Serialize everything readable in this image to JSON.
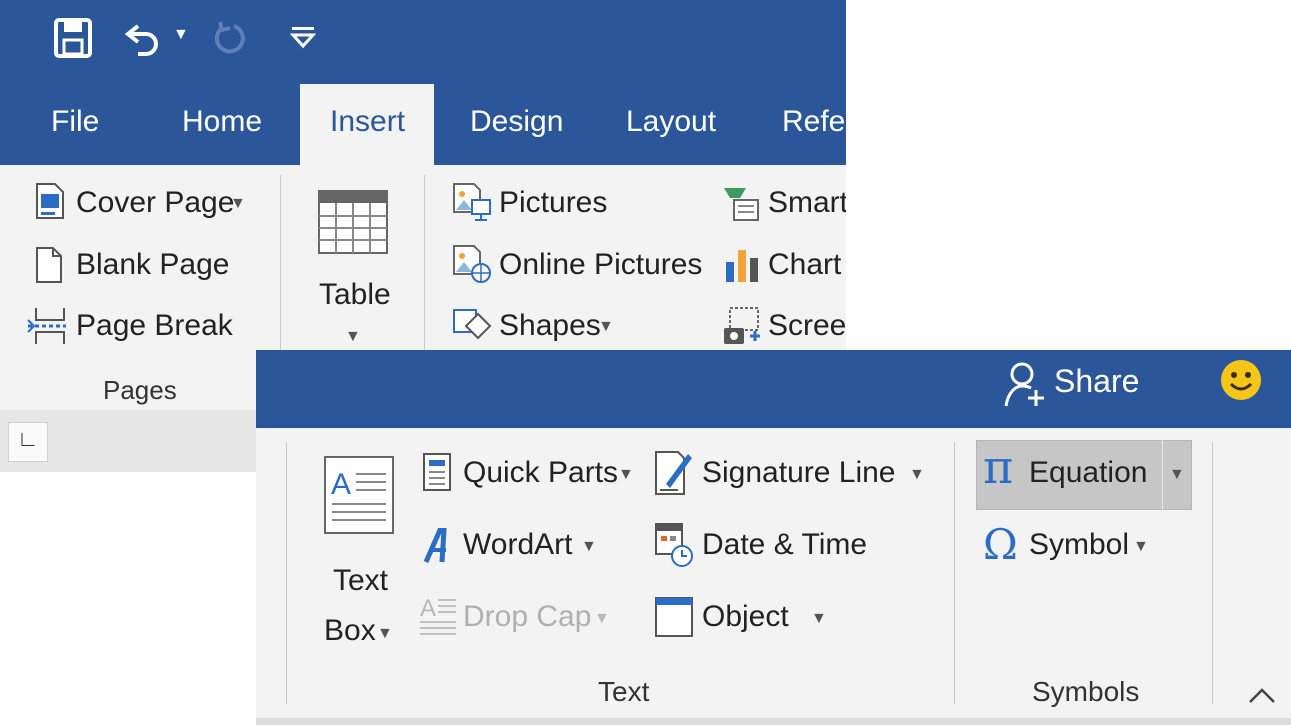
{
  "colors": {
    "title_bar": "#2b579a",
    "ribbon_bg": "#f3f3f3",
    "active_tab_bg": "#f3f3f3",
    "equation_highlight": "#c6c6c6",
    "smiley": "#f5c518"
  },
  "quick_access": {
    "save_icon": "save-icon",
    "undo_icon": "undo-icon",
    "redo_icon": "redo-icon",
    "customize_icon": "customize-qat-icon"
  },
  "tabs": [
    "File",
    "Home",
    "Insert",
    "Design",
    "Layout",
    "Refer"
  ],
  "active_tab": "Insert",
  "pages_group": {
    "items": [
      {
        "label": "Cover Page",
        "icon": "cover-page-icon",
        "has_dropdown": true
      },
      {
        "label": "Blank Page",
        "icon": "blank-page-icon",
        "has_dropdown": false
      },
      {
        "label": "Page Break",
        "icon": "page-break-icon",
        "has_dropdown": false
      }
    ],
    "group_label": "Pages"
  },
  "tables_group": {
    "table_label": "Table"
  },
  "illustrations_group": {
    "col1": [
      {
        "label": "Pictures",
        "icon": "pictures-icon",
        "has_dropdown": false
      },
      {
        "label": "Online Pictures",
        "icon": "online-pictures-icon",
        "has_dropdown": false
      },
      {
        "label": "Shapes",
        "icon": "shapes-icon",
        "has_dropdown": true
      }
    ],
    "col2": [
      {
        "label": "Smart",
        "icon": "smartart-icon"
      },
      {
        "label": "Chart",
        "icon": "chart-icon"
      },
      {
        "label": "Screen",
        "icon": "screenshot-icon"
      }
    ]
  },
  "ruler_tab_glyph": "∟",
  "share": {
    "label": "Share",
    "icon": "share-person-icon"
  },
  "feedback_icon": "smiley-icon",
  "text_group": {
    "text_box_line1": "Text",
    "text_box_line2": "Box",
    "items_col1": [
      {
        "label": "Quick Parts",
        "icon": "quick-parts-icon",
        "has_dropdown": true,
        "disabled": false
      },
      {
        "label": "WordArt",
        "icon": "wordart-icon",
        "has_dropdown": true,
        "disabled": false
      },
      {
        "label": "Drop Cap",
        "icon": "drop-cap-icon",
        "has_dropdown": true,
        "disabled": true
      }
    ],
    "items_col2": [
      {
        "label": "Signature Line",
        "icon": "signature-line-icon",
        "has_dropdown": true
      },
      {
        "label": "Date & Time",
        "icon": "date-time-icon",
        "has_dropdown": false
      },
      {
        "label": "Object",
        "icon": "object-icon",
        "has_dropdown": true
      }
    ],
    "group_label": "Text"
  },
  "symbols_group": {
    "equation": {
      "label": "Equation",
      "glyph": "π"
    },
    "symbol": {
      "label": "Symbol",
      "glyph": "Ω"
    },
    "group_label": "Symbols"
  },
  "collapse_icon": "collapse-ribbon-icon"
}
